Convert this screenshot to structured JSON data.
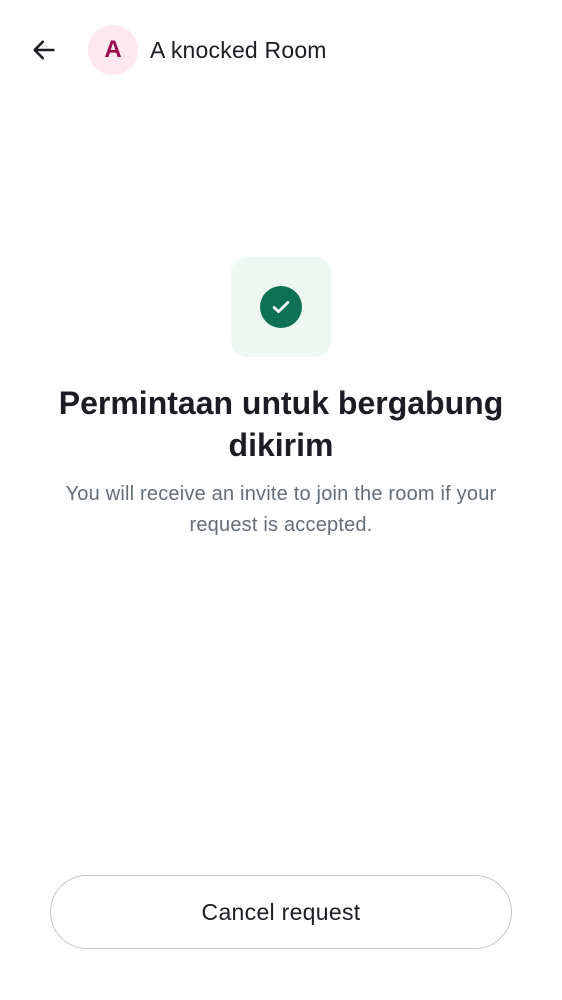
{
  "colors": {
    "text_primary": "#1b1d22",
    "text_secondary": "#656d77",
    "avatar_bg": "#fde8ef",
    "avatar_text": "#9b0a4e",
    "success_bg": "#eef7f2",
    "success_icon": "#0e7154",
    "button_border": "#c2c6cc"
  },
  "header": {
    "back_icon": "arrow-left-icon",
    "avatar_letter": "A",
    "room_name": "A knocked Room"
  },
  "status": {
    "icon": "check-circle-icon",
    "title": "Permintaan untuk bergabung dikirim",
    "description": "You will receive an invite to join the room if your request is accepted."
  },
  "actions": {
    "cancel_label": "Cancel request"
  }
}
